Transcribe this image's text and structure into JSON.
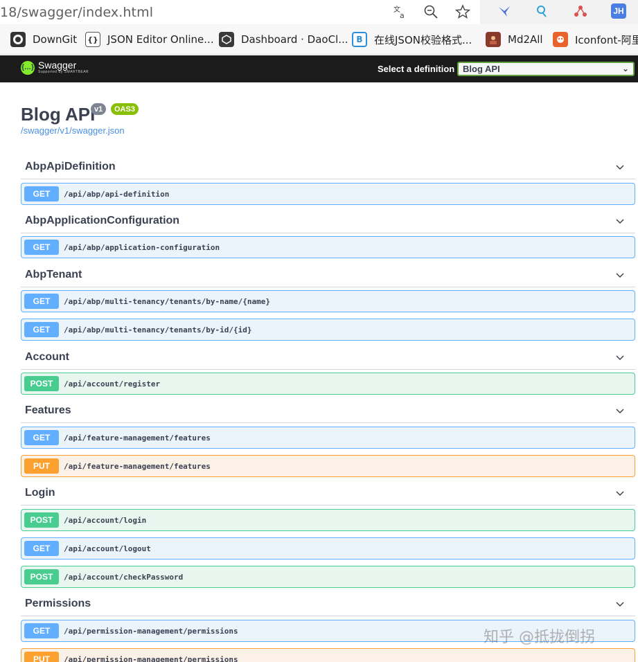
{
  "browser": {
    "url": "18/swagger/index.html",
    "bookmarks": [
      {
        "label": "DownGit",
        "icon": "github-icon",
        "color": "#333333"
      },
      {
        "label": "JSON Editor Online...",
        "icon": "braces-icon",
        "color": "#444444"
      },
      {
        "label": "Dashboard · DaoCl...",
        "icon": "daocloud-icon",
        "color": "#3a3a3a"
      },
      {
        "label": "在线JSON校验格式...",
        "icon": "bejson-icon",
        "color": "#2a8fd8"
      },
      {
        "label": "Md2All",
        "icon": "md2all-icon",
        "color": "#8a3a2a"
      },
      {
        "label": "Iconfont-阿里",
        "icon": "iconfont-icon",
        "color": "#e8622c"
      }
    ],
    "extension_badge": "JH"
  },
  "topbar": {
    "logo_title": "Swagger",
    "logo_sub": "Supported by SMARTBEAR",
    "select_label": "Select a definition",
    "selected_definition": "Blog API",
    "accent": "#62a03f"
  },
  "info": {
    "title": "Blog API",
    "version": "v1",
    "oas": "OAS3",
    "spec_link": "/swagger/v1/swagger.json"
  },
  "tags": [
    {
      "name": "AbpApiDefinition",
      "ops": [
        {
          "method": "GET",
          "path": "/api/abp/api-definition"
        }
      ]
    },
    {
      "name": "AbpApplicationConfiguration",
      "ops": [
        {
          "method": "GET",
          "path": "/api/abp/application-configuration"
        }
      ]
    },
    {
      "name": "AbpTenant",
      "ops": [
        {
          "method": "GET",
          "path": "/api/abp/multi-tenancy/tenants/by-name/{name}"
        },
        {
          "method": "GET",
          "path": "/api/abp/multi-tenancy/tenants/by-id/{id}"
        }
      ]
    },
    {
      "name": "Account",
      "ops": [
        {
          "method": "POST",
          "path": "/api/account/register"
        }
      ]
    },
    {
      "name": "Features",
      "ops": [
        {
          "method": "GET",
          "path": "/api/feature-management/features"
        },
        {
          "method": "PUT",
          "path": "/api/feature-management/features"
        }
      ]
    },
    {
      "name": "Login",
      "ops": [
        {
          "method": "POST",
          "path": "/api/account/login"
        },
        {
          "method": "GET",
          "path": "/api/account/logout"
        },
        {
          "method": "POST",
          "path": "/api/account/checkPassword"
        }
      ]
    },
    {
      "name": "Permissions",
      "ops": [
        {
          "method": "GET",
          "path": "/api/permission-management/permissions"
        },
        {
          "method": "PUT",
          "path": "/api/permission-management/permissions"
        }
      ]
    }
  ],
  "watermark": "知乎 @抵拢倒拐"
}
